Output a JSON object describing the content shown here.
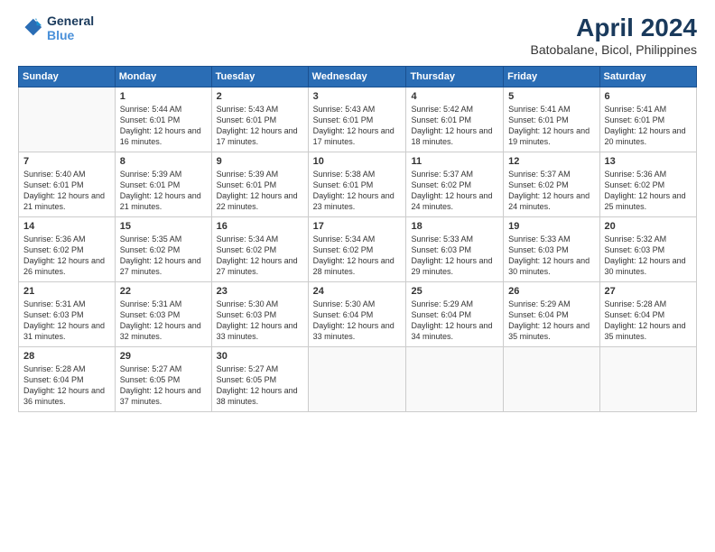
{
  "logo": {
    "line1": "General",
    "line2": "Blue"
  },
  "title": "April 2024",
  "location": "Batobalane, Bicol, Philippines",
  "weekdays": [
    "Sunday",
    "Monday",
    "Tuesday",
    "Wednesday",
    "Thursday",
    "Friday",
    "Saturday"
  ],
  "weeks": [
    [
      {
        "day": "",
        "sunrise": "",
        "sunset": "",
        "daylight": ""
      },
      {
        "day": "1",
        "sunrise": "Sunrise: 5:44 AM",
        "sunset": "Sunset: 6:01 PM",
        "daylight": "Daylight: 12 hours and 16 minutes."
      },
      {
        "day": "2",
        "sunrise": "Sunrise: 5:43 AM",
        "sunset": "Sunset: 6:01 PM",
        "daylight": "Daylight: 12 hours and 17 minutes."
      },
      {
        "day": "3",
        "sunrise": "Sunrise: 5:43 AM",
        "sunset": "Sunset: 6:01 PM",
        "daylight": "Daylight: 12 hours and 17 minutes."
      },
      {
        "day": "4",
        "sunrise": "Sunrise: 5:42 AM",
        "sunset": "Sunset: 6:01 PM",
        "daylight": "Daylight: 12 hours and 18 minutes."
      },
      {
        "day": "5",
        "sunrise": "Sunrise: 5:41 AM",
        "sunset": "Sunset: 6:01 PM",
        "daylight": "Daylight: 12 hours and 19 minutes."
      },
      {
        "day": "6",
        "sunrise": "Sunrise: 5:41 AM",
        "sunset": "Sunset: 6:01 PM",
        "daylight": "Daylight: 12 hours and 20 minutes."
      }
    ],
    [
      {
        "day": "7",
        "sunrise": "Sunrise: 5:40 AM",
        "sunset": "Sunset: 6:01 PM",
        "daylight": "Daylight: 12 hours and 21 minutes."
      },
      {
        "day": "8",
        "sunrise": "Sunrise: 5:39 AM",
        "sunset": "Sunset: 6:01 PM",
        "daylight": "Daylight: 12 hours and 21 minutes."
      },
      {
        "day": "9",
        "sunrise": "Sunrise: 5:39 AM",
        "sunset": "Sunset: 6:01 PM",
        "daylight": "Daylight: 12 hours and 22 minutes."
      },
      {
        "day": "10",
        "sunrise": "Sunrise: 5:38 AM",
        "sunset": "Sunset: 6:01 PM",
        "daylight": "Daylight: 12 hours and 23 minutes."
      },
      {
        "day": "11",
        "sunrise": "Sunrise: 5:37 AM",
        "sunset": "Sunset: 6:02 PM",
        "daylight": "Daylight: 12 hours and 24 minutes."
      },
      {
        "day": "12",
        "sunrise": "Sunrise: 5:37 AM",
        "sunset": "Sunset: 6:02 PM",
        "daylight": "Daylight: 12 hours and 24 minutes."
      },
      {
        "day": "13",
        "sunrise": "Sunrise: 5:36 AM",
        "sunset": "Sunset: 6:02 PM",
        "daylight": "Daylight: 12 hours and 25 minutes."
      }
    ],
    [
      {
        "day": "14",
        "sunrise": "Sunrise: 5:36 AM",
        "sunset": "Sunset: 6:02 PM",
        "daylight": "Daylight: 12 hours and 26 minutes."
      },
      {
        "day": "15",
        "sunrise": "Sunrise: 5:35 AM",
        "sunset": "Sunset: 6:02 PM",
        "daylight": "Daylight: 12 hours and 27 minutes."
      },
      {
        "day": "16",
        "sunrise": "Sunrise: 5:34 AM",
        "sunset": "Sunset: 6:02 PM",
        "daylight": "Daylight: 12 hours and 27 minutes."
      },
      {
        "day": "17",
        "sunrise": "Sunrise: 5:34 AM",
        "sunset": "Sunset: 6:02 PM",
        "daylight": "Daylight: 12 hours and 28 minutes."
      },
      {
        "day": "18",
        "sunrise": "Sunrise: 5:33 AM",
        "sunset": "Sunset: 6:03 PM",
        "daylight": "Daylight: 12 hours and 29 minutes."
      },
      {
        "day": "19",
        "sunrise": "Sunrise: 5:33 AM",
        "sunset": "Sunset: 6:03 PM",
        "daylight": "Daylight: 12 hours and 30 minutes."
      },
      {
        "day": "20",
        "sunrise": "Sunrise: 5:32 AM",
        "sunset": "Sunset: 6:03 PM",
        "daylight": "Daylight: 12 hours and 30 minutes."
      }
    ],
    [
      {
        "day": "21",
        "sunrise": "Sunrise: 5:31 AM",
        "sunset": "Sunset: 6:03 PM",
        "daylight": "Daylight: 12 hours and 31 minutes."
      },
      {
        "day": "22",
        "sunrise": "Sunrise: 5:31 AM",
        "sunset": "Sunset: 6:03 PM",
        "daylight": "Daylight: 12 hours and 32 minutes."
      },
      {
        "day": "23",
        "sunrise": "Sunrise: 5:30 AM",
        "sunset": "Sunset: 6:03 PM",
        "daylight": "Daylight: 12 hours and 33 minutes."
      },
      {
        "day": "24",
        "sunrise": "Sunrise: 5:30 AM",
        "sunset": "Sunset: 6:04 PM",
        "daylight": "Daylight: 12 hours and 33 minutes."
      },
      {
        "day": "25",
        "sunrise": "Sunrise: 5:29 AM",
        "sunset": "Sunset: 6:04 PM",
        "daylight": "Daylight: 12 hours and 34 minutes."
      },
      {
        "day": "26",
        "sunrise": "Sunrise: 5:29 AM",
        "sunset": "Sunset: 6:04 PM",
        "daylight": "Daylight: 12 hours and 35 minutes."
      },
      {
        "day": "27",
        "sunrise": "Sunrise: 5:28 AM",
        "sunset": "Sunset: 6:04 PM",
        "daylight": "Daylight: 12 hours and 35 minutes."
      }
    ],
    [
      {
        "day": "28",
        "sunrise": "Sunrise: 5:28 AM",
        "sunset": "Sunset: 6:04 PM",
        "daylight": "Daylight: 12 hours and 36 minutes."
      },
      {
        "day": "29",
        "sunrise": "Sunrise: 5:27 AM",
        "sunset": "Sunset: 6:05 PM",
        "daylight": "Daylight: 12 hours and 37 minutes."
      },
      {
        "day": "30",
        "sunrise": "Sunrise: 5:27 AM",
        "sunset": "Sunset: 6:05 PM",
        "daylight": "Daylight: 12 hours and 38 minutes."
      },
      {
        "day": "",
        "sunrise": "",
        "sunset": "",
        "daylight": ""
      },
      {
        "day": "",
        "sunrise": "",
        "sunset": "",
        "daylight": ""
      },
      {
        "day": "",
        "sunrise": "",
        "sunset": "",
        "daylight": ""
      },
      {
        "day": "",
        "sunrise": "",
        "sunset": "",
        "daylight": ""
      }
    ]
  ]
}
